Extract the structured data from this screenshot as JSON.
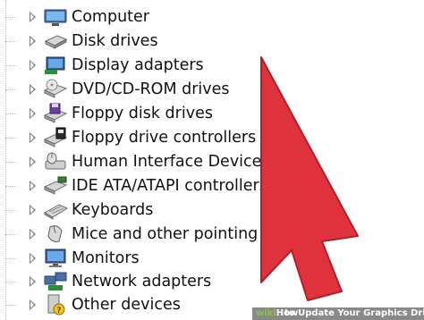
{
  "device_manager": {
    "categories": [
      {
        "label": "Computer",
        "icon": "computer-icon"
      },
      {
        "label": "Disk drives",
        "icon": "disk-drive-icon"
      },
      {
        "label": "Display adapters",
        "icon": "display-adapter-icon"
      },
      {
        "label": "DVD/CD-ROM drives",
        "icon": "dvd-drive-icon"
      },
      {
        "label": "Floppy disk drives",
        "icon": "floppy-disk-icon"
      },
      {
        "label": "Floppy drive controllers",
        "icon": "floppy-controller-icon"
      },
      {
        "label": "Human Interface Devices",
        "icon": "hid-icon"
      },
      {
        "label": "IDE ATA/ATAPI controllers",
        "icon": "ide-controller-icon"
      },
      {
        "label": "Keyboards",
        "icon": "keyboard-icon"
      },
      {
        "label": "Mice and other pointing devices",
        "icon": "mouse-icon"
      },
      {
        "label": "Monitors",
        "icon": "monitor-icon"
      },
      {
        "label": "Network adapters",
        "icon": "network-adapter-icon"
      },
      {
        "label": "Other devices",
        "icon": "other-devices-icon"
      }
    ]
  },
  "pointer": {
    "color": "#e0323c",
    "icon": "red-arrow-pointer"
  },
  "watermark": {
    "logo_prefix": "wiki",
    "logo_suffix": "How",
    "text": "to Update Your Graphics Driver"
  }
}
